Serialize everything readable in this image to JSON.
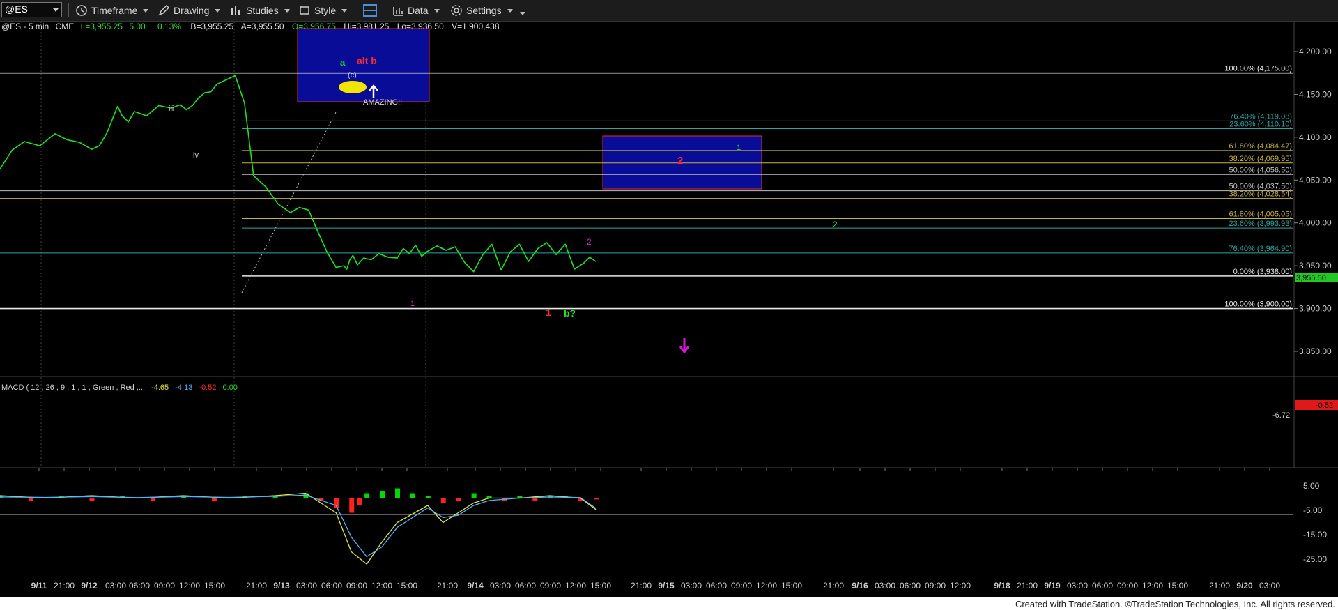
{
  "toolbar": {
    "symbol": "@ES",
    "timeframe_label": "Timeframe",
    "drawing_label": "Drawing",
    "studies_label": "Studies",
    "style_label": "Style",
    "data_label": "Data",
    "settings_label": "Settings"
  },
  "header": {
    "symbol": "@ES - 5 min",
    "exchange": "CME",
    "last": "L=3,955.25",
    "change": "5.00",
    "pct": "0.13%",
    "bid": "B=3,955.25",
    "ask": "A=3,955.50",
    "open": "O=3,956.75",
    "high": "Hi=3,981.25",
    "low": "Lo=3,936.50",
    "volume": "V=1,900,438"
  },
  "colors": {
    "up": "#00d800",
    "down": "#ff2020",
    "grid": "#333",
    "price_line": "#19e619"
  },
  "chart_data": [
    {
      "type": "line",
      "title": "@ES - 5 min",
      "ylim": [
        3825,
        4230
      ],
      "x_ticks": [
        "9/11",
        "21:00",
        "9/12",
        "03:00",
        "06:00",
        "09:00",
        "12:00",
        "15:00",
        "21:00",
        "9/13",
        "03:00",
        "06:00",
        "09:00",
        "12:00",
        "15:00",
        "21:00",
        "9/14",
        "03:00",
        "06:00",
        "09:00",
        "12:00",
        "15:00",
        "21:00",
        "9/15",
        "03:00",
        "06:00",
        "09:00",
        "12:00",
        "15:00",
        "21:00",
        "9/16",
        "03:00",
        "06:00",
        "09:00",
        "12:00",
        "9/18",
        "21:00",
        "9/19",
        "03:00",
        "06:00",
        "09:00",
        "12:00",
        "15:00",
        "21:00",
        "9/20",
        "03:00"
      ],
      "y_ticks": [
        "4,200.00",
        "4,150.00",
        "4,100.00",
        "4,050.00",
        "4,000.00",
        "3,950.00",
        "3,900.00",
        "3,850.00"
      ],
      "series": [
        {
          "x": [
            0,
            0.8,
            1.6,
            2.6,
            3.6,
            4.4,
            5.2,
            6.0,
            6.5,
            7.0,
            7.4,
            7.7,
            8.0,
            8.4,
            8.8,
            9.6,
            10.4,
            11.2,
            11.8,
            12.2,
            12.6,
            13.0,
            13.4,
            13.8,
            14.2,
            14.8,
            15.4,
            16.0,
            16.6,
            17.4,
            18.2,
            19.0,
            19.6,
            20.2,
            20.8,
            21.4,
            22.0,
            22.5,
            22.7,
            22.9,
            23.1,
            23.4,
            23.8,
            24.3,
            24.8,
            25.4,
            26.0,
            26.4,
            26.8,
            27.2,
            27.6,
            28.0,
            28.6,
            29.2,
            29.8,
            30.4,
            31.0,
            31.6,
            32.2,
            32.8,
            33.4,
            34.0,
            34.6,
            35.2,
            35.8,
            36.4,
            37.0,
            37.6,
            38.2,
            38.6,
            39.0
          ],
          "y": [
            4063,
            4085,
            4095,
            4090,
            4104,
            4097,
            4094,
            4086,
            4090,
            4105,
            4123,
            4136,
            4125,
            4118,
            4130,
            4125,
            4137,
            4134,
            4138,
            4132,
            4137,
            4146,
            4152,
            4153,
            4162,
            4167,
            4172,
            4140,
            4055,
            4042,
            4022,
            4012,
            4018,
            4015,
            3990,
            3966,
            3948,
            3950,
            3946,
            3957,
            3962,
            3951,
            3959,
            3957,
            3964,
            3960,
            3959,
            3970,
            3964,
            3974,
            3961,
            3967,
            3973,
            3968,
            3972,
            3954,
            3943,
            3963,
            3975,
            3945,
            3966,
            3975,
            3955,
            3970,
            3977,
            3963,
            3975,
            3946,
            3953,
            3960,
            3955
          ]
        }
      ],
      "price_marker": "3,955.50",
      "fib_lines": [
        {
          "label": "100.00% (4,175.00)",
          "value": 4175,
          "color": "#e8e8e8"
        },
        {
          "label": "76.40% (4,119.08)",
          "value": 4119.08,
          "color": "#2aa6a6"
        },
        {
          "label": "23.60% (4,110.10)",
          "value": 4110.1,
          "color": "#2aa6a6"
        },
        {
          "label": "61.80% (4,084.47)",
          "value": 4084.47,
          "color": "#c9b43a"
        },
        {
          "label": "38.20% (4,069.95)",
          "value": 4069.95,
          "color": "#c9b43a"
        },
        {
          "label": "50.00% (4,056.50)",
          "value": 4056.5,
          "color": "#bfbfbf"
        },
        {
          "label": "50.00% (4,037.50)",
          "value": 4037.5,
          "color": "#bfbfbf"
        },
        {
          "label": "38.20% (4,028.54)",
          "value": 4028.54,
          "color": "#c9b43a"
        },
        {
          "label": "61.80% (4,005.05)",
          "value": 4005.05,
          "color": "#c9b43a"
        },
        {
          "label": "23.60% (3,993.93)",
          "value": 3993.93,
          "color": "#2aa6a6"
        },
        {
          "label": "76.40% (3,964.90)",
          "value": 3964.9,
          "color": "#2aa6a6"
        },
        {
          "label": "0.00% (3,938.00)",
          "value": 3938,
          "color": "#e8e8e8"
        },
        {
          "label": "100.00% (3,900.00)",
          "value": 3900,
          "color": "#e8e8e8"
        }
      ],
      "annotations": [
        {
          "text": "a",
          "color": "#22e022"
        },
        {
          "text": "alt b",
          "color": "#ff2a2a"
        },
        {
          "text": "(c)",
          "color": "#c8c8ff"
        },
        {
          "text": "AMAZING!!",
          "color": "#d8d8d8"
        },
        {
          "text": "iii",
          "color": "#cfcfcf"
        },
        {
          "text": "iv",
          "color": "#cfcfcf"
        },
        {
          "text": "1",
          "color": "#d12ad1"
        },
        {
          "text": "2",
          "color": "#d12ad1"
        },
        {
          "text": "1",
          "color": "#ff2a2a"
        },
        {
          "text": "b?",
          "color": "#22e022"
        },
        {
          "text": "2",
          "color": "#ff2a2a"
        },
        {
          "text": "1",
          "color": "#22e022"
        },
        {
          "text": "2",
          "color": "#22e022"
        }
      ]
    },
    {
      "type": "line",
      "title": "MACD ( 12 , 26 , 9 , 1 , 1 , Green , Red ,...",
      "legend_values": [
        {
          "text": "-4.65",
          "color": "#e6e63a"
        },
        {
          "text": "-4.13",
          "color": "#4fb3ff"
        },
        {
          "text": "-0.52",
          "color": "#ff3030"
        },
        {
          "text": "0.00",
          "color": "#22e022"
        }
      ],
      "ylim": [
        -28,
        7
      ],
      "y_ticks": [
        "5.00",
        "-5.00",
        "-15.00",
        "-25.00"
      ],
      "right_markers": [
        {
          "text": "-0.52",
          "value": -0.52,
          "color": "#ff2020"
        },
        {
          "text": "-6.72",
          "value": -6.72,
          "color": "#d0d0d0"
        }
      ],
      "series": [
        {
          "name": "MACD",
          "x": [
            0,
            3,
            6,
            9,
            12,
            15,
            18,
            20,
            22,
            23,
            24,
            25,
            26,
            28,
            29,
            30,
            31,
            32,
            34,
            36,
            38,
            39
          ],
          "y": [
            1,
            0,
            1,
            0,
            1,
            0,
            1,
            2,
            -6,
            -22,
            -27,
            -18,
            -10,
            -3,
            -10,
            -6,
            -2,
            0,
            0,
            1,
            0,
            -4.65
          ]
        },
        {
          "name": "Signal",
          "x": [
            0,
            3,
            6,
            9,
            12,
            15,
            18,
            20,
            22,
            23,
            24,
            25,
            26,
            28,
            29,
            30,
            31,
            32,
            34,
            36,
            38,
            39
          ],
          "y": [
            0.5,
            0.3,
            0.6,
            0.2,
            0.6,
            0.3,
            0.7,
            1.2,
            -3,
            -16,
            -24,
            -20,
            -12,
            -4,
            -8,
            -7,
            -3,
            -1,
            0,
            0.5,
            0.2,
            -4.13
          ]
        },
        {
          "name": "Histogram",
          "x": [
            0,
            2,
            4,
            6,
            8,
            10,
            12,
            14,
            16,
            18,
            20,
            21,
            22,
            23,
            23.5,
            24,
            25,
            26,
            27,
            28,
            29,
            30,
            31,
            32,
            33,
            34,
            35,
            36,
            37,
            38,
            39
          ],
          "y": [
            1,
            -1,
            1,
            -1,
            1,
            -1,
            1,
            -1,
            1,
            1,
            2,
            -1,
            -4,
            -6,
            -3,
            2,
            3,
            4,
            2,
            1,
            -2,
            -1,
            2,
            1,
            -1,
            1,
            -1,
            1,
            1,
            -1,
            -0.52
          ]
        }
      ]
    }
  ],
  "footer": {
    "credit": "Created with TradeStation. ©TradeStation Technologies, Inc. All rights reserved."
  }
}
